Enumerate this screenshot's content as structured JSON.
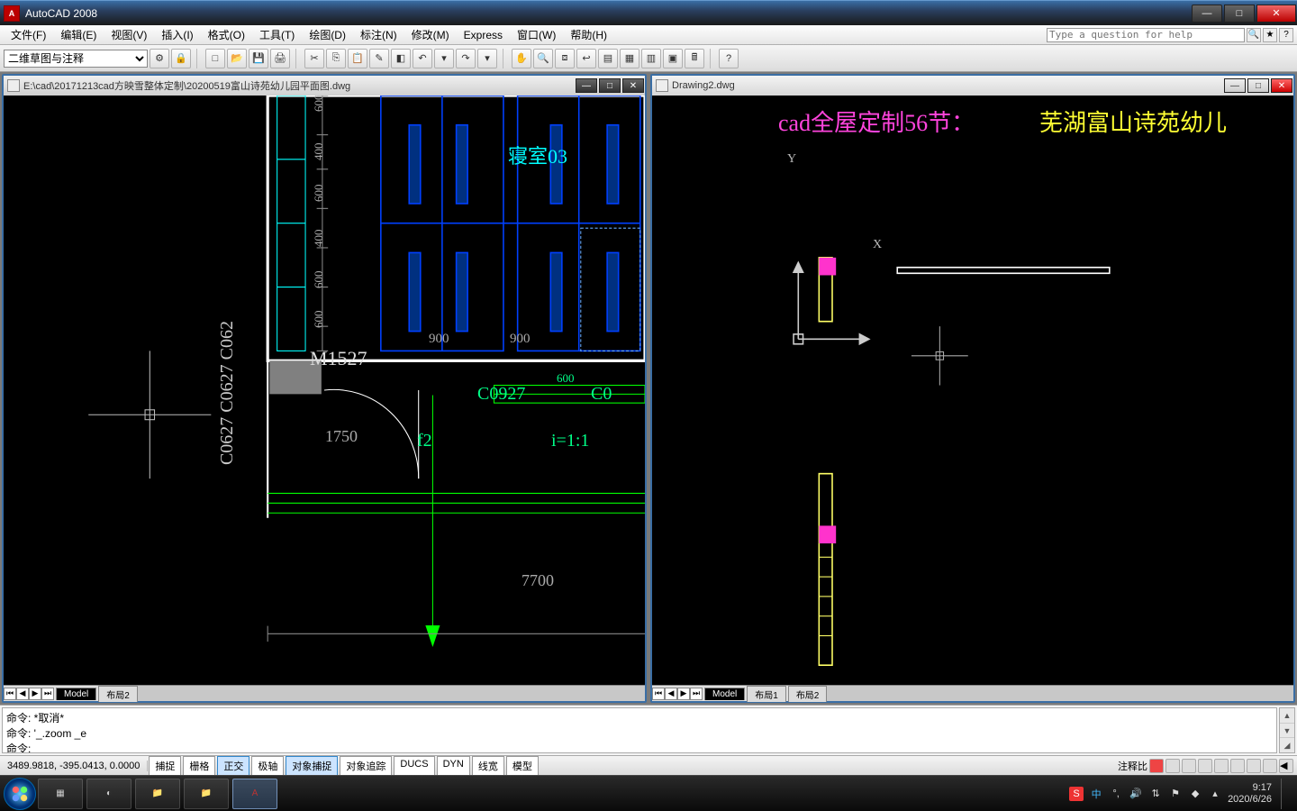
{
  "app": {
    "title": "AutoCAD 2008",
    "help_placeholder": "Type a question for help"
  },
  "menu": [
    "文件(F)",
    "编辑(E)",
    "视图(V)",
    "插入(I)",
    "格式(O)",
    "工具(T)",
    "绘图(D)",
    "标注(N)",
    "修改(M)",
    "Express",
    "窗口(W)",
    "帮助(H)"
  ],
  "workspace_dropdown": "二维草图与注释",
  "child_left": {
    "title": "E:\\cad\\20171213cad方映雪整体定制\\20200519富山诗苑幼儿园平面图.dwg",
    "tabs": [
      "Model",
      "布局2"
    ]
  },
  "child_right": {
    "title": "Drawing2.dwg",
    "tabs": [
      "Model",
      "布局1",
      "布局2"
    ],
    "overlay_text_pink": "cad全屋定制56节：",
    "overlay_text_yellow": "芜湖富山诗苑幼儿",
    "axis_x": "X",
    "axis_y": "Y"
  },
  "left_drawing": {
    "room_label": "寝室03",
    "door_label": "M1527",
    "win_label": "C0927",
    "win_label2": "C0",
    "side_text": "C0627 C0627 C062",
    "scale_text": "i=1:1",
    "dim_600": "600",
    "dim_400": "400",
    "dim_900a": "900",
    "dim_900b": "900",
    "dim_1750": "1750",
    "dim_7700": "7700",
    "marker_f2": "f2"
  },
  "command": {
    "line1": "命令: *取消*",
    "line2": "命令: '_.zoom _e",
    "prompt": "命令:"
  },
  "status": {
    "coords": "3489.9818, -395.0413, 0.0000",
    "toggles": [
      {
        "label": "捕捉",
        "on": false
      },
      {
        "label": "栅格",
        "on": false
      },
      {
        "label": "正交",
        "on": true
      },
      {
        "label": "极轴",
        "on": false
      },
      {
        "label": "对象捕捉",
        "on": true
      },
      {
        "label": "对象追踪",
        "on": false
      },
      {
        "label": "DUCS",
        "on": false
      },
      {
        "label": "DYN",
        "on": false
      },
      {
        "label": "线宽",
        "on": false
      },
      {
        "label": "模型",
        "on": false
      }
    ],
    "right_label": "注释比"
  },
  "tray": {
    "ime": "中",
    "time": "9:17",
    "date": "2020/6/26"
  }
}
